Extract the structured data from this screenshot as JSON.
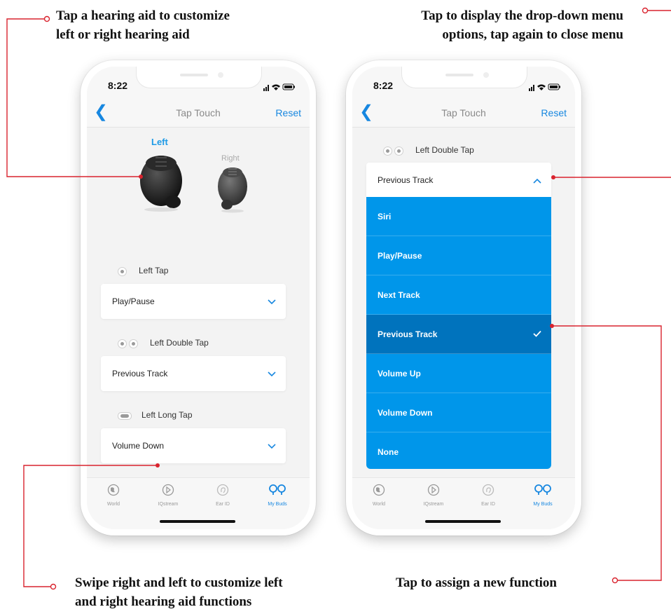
{
  "callouts": {
    "top_left": [
      "Tap a hearing aid to customize",
      "left or right hearing aid"
    ],
    "top_right": [
      "Tap to display the drop-down menu",
      "options, tap again to close menu"
    ],
    "bottom_left": [
      "Swipe right and left to customize left",
      "and right hearing aid functions"
    ],
    "bottom_right": "Tap to assign a new function"
  },
  "accent_color": "#1787e0",
  "dropdown_color": "#0096ea",
  "dropdown_selected_color": "#0073bd",
  "callout_line_color": "#d9232e",
  "phone1": {
    "time": "8:22",
    "title": "Tap Touch",
    "reset": "Reset",
    "left_label": "Left",
    "right_label": "Right",
    "left_tap_label": "Left Tap",
    "left_tap_value": "Play/Pause",
    "double_tap_label": "Left Double Tap",
    "double_tap_value": "Previous Track",
    "long_tap_label": "Left Long Tap",
    "long_tap_value": "Volume Down"
  },
  "phone2": {
    "time": "8:22",
    "title": "Tap Touch",
    "reset": "Reset",
    "double_tap_label": "Left Double Tap",
    "dropdown_header": "Previous Track",
    "options": [
      "Siri",
      "Play/Pause",
      "Next Track",
      "Previous Track",
      "Volume Up",
      "Volume Down",
      "None"
    ],
    "selected_option": "Previous Track"
  },
  "tabs": [
    {
      "label": "World",
      "icon": "globe-icon"
    },
    {
      "label": "IQstream",
      "icon": "stream-icon"
    },
    {
      "label": "Ear ID",
      "icon": "ear-id-icon"
    },
    {
      "label": "My Buds",
      "icon": "buds-icon"
    }
  ]
}
